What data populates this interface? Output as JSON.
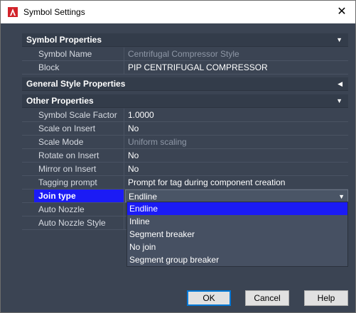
{
  "window": {
    "title": "Symbol Settings",
    "close_glyph": "✕",
    "app_icon": "autocad-a-icon",
    "accent": "#d2232a"
  },
  "sections": {
    "symbol_properties": {
      "label": "Symbol Properties",
      "expanded": true
    },
    "general_style_properties": {
      "label": "General Style Properties",
      "expanded": false
    },
    "other_properties": {
      "label": "Other Properties",
      "expanded": true
    }
  },
  "symbol_properties": [
    {
      "name": "Symbol Name",
      "value": "Centrifugal Compressor Style",
      "readonly": true
    },
    {
      "name": "Block",
      "value": "PIP CENTRIFUGAL COMPRESSOR",
      "readonly": false
    }
  ],
  "other_properties": [
    {
      "name": "Symbol Scale Factor",
      "value": "1.0000",
      "readonly": false
    },
    {
      "name": "Scale on Insert",
      "value": "No",
      "readonly": false
    },
    {
      "name": "Scale Mode",
      "value": "Uniform scaling",
      "readonly": true
    },
    {
      "name": "Rotate on Insert",
      "value": "No",
      "readonly": false
    },
    {
      "name": "Mirror on Insert",
      "value": "No",
      "readonly": false
    },
    {
      "name": "Tagging prompt",
      "value": "Prompt for tag during component creation",
      "readonly": false
    },
    {
      "name": "Join type",
      "value": "Endline",
      "readonly": false,
      "selected": true
    },
    {
      "name": "Auto Nozzle",
      "value": "",
      "readonly": false
    },
    {
      "name": "Auto Nozzle Style",
      "value": "",
      "readonly": false
    }
  ],
  "join_type_dropdown": {
    "selected": "Endline",
    "options": [
      "Endline",
      "Inline",
      "Segment breaker",
      "No join",
      "Segment group breaker"
    ]
  },
  "buttons": {
    "ok": "OK",
    "cancel": "Cancel",
    "help": "Help"
  },
  "colors": {
    "background": "#3b4453",
    "selection": "#1b1bf5",
    "default_button_border": "#0078d7"
  }
}
